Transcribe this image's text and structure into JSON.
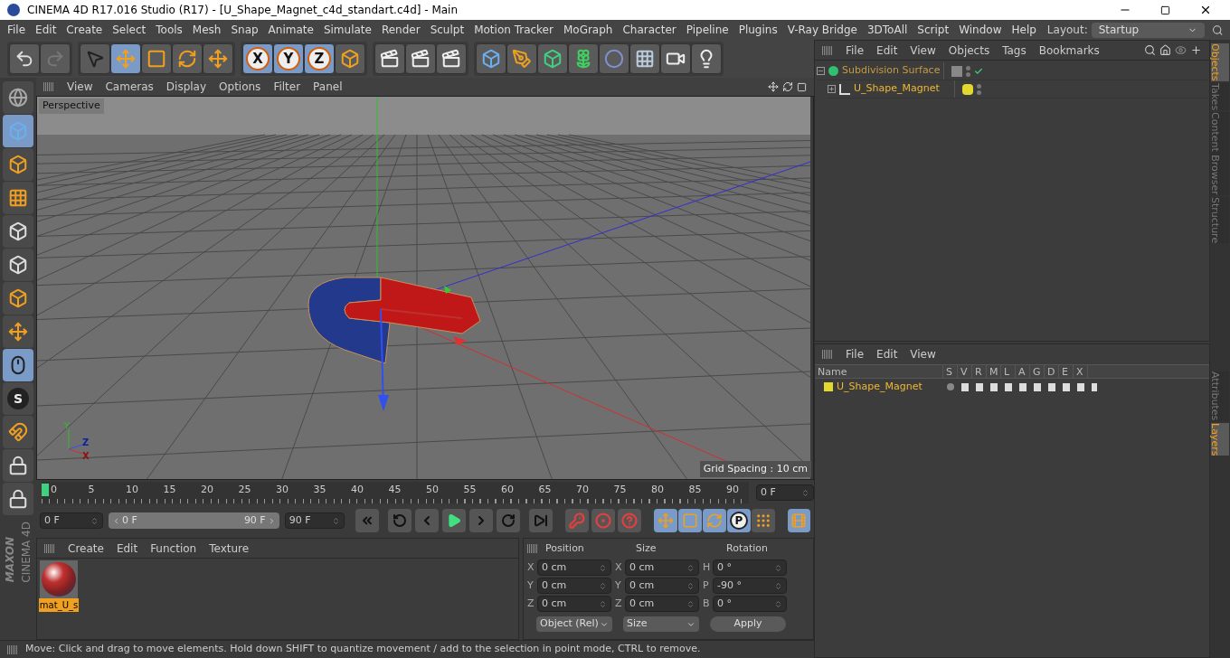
{
  "window": {
    "title": "CINEMA 4D R17.016 Studio (R17) - [U_Shape_Magnet_c4d_standart.c4d] - Main"
  },
  "menu": [
    "File",
    "Edit",
    "Create",
    "Select",
    "Tools",
    "Mesh",
    "Snap",
    "Animate",
    "Simulate",
    "Render",
    "Sculpt",
    "Motion Tracker",
    "MoGraph",
    "Character",
    "Pipeline",
    "Plugins",
    "V-Ray Bridge",
    "3DToAll",
    "Script",
    "Window",
    "Help"
  ],
  "layout": {
    "label": "Layout:",
    "value": "Startup"
  },
  "toolbar": [
    [
      {
        "kind": "undo",
        "selected": false
      },
      {
        "kind": "redo",
        "selected": false
      }
    ],
    [
      {
        "kind": "select",
        "selected": false
      },
      {
        "kind": "move",
        "selected": true
      },
      {
        "kind": "scale",
        "selected": false
      },
      {
        "kind": "rotate",
        "selected": false
      },
      {
        "kind": "move",
        "selected": false
      }
    ],
    [
      {
        "kind": "axis",
        "label": "X",
        "selected": true
      },
      {
        "kind": "axis",
        "label": "Y",
        "selected": true
      },
      {
        "kind": "axis",
        "label": "Z",
        "selected": true
      },
      {
        "kind": "coords",
        "selected": false
      }
    ],
    [
      {
        "kind": "render",
        "selected": false
      },
      {
        "kind": "render",
        "selected": false
      },
      {
        "kind": "render",
        "selected": false
      }
    ],
    [
      {
        "kind": "cube",
        "selected": false
      },
      {
        "kind": "pen",
        "selected": false
      },
      {
        "kind": "subdivision",
        "selected": false
      },
      {
        "kind": "cloner",
        "selected": false
      },
      {
        "kind": "deformer",
        "selected": false
      },
      {
        "kind": "floor",
        "selected": false
      },
      {
        "kind": "camera",
        "selected": false
      },
      {
        "kind": "light",
        "selected": false
      }
    ]
  ],
  "left_tools": [
    {
      "kind": "globe",
      "selected": false
    },
    {
      "kind": "cube",
      "selected": true
    },
    {
      "kind": "checker",
      "selected": false
    },
    {
      "kind": "grid",
      "selected": false
    },
    {
      "kind": "points",
      "selected": false
    },
    {
      "kind": "edges",
      "selected": false
    },
    {
      "kind": "polygons",
      "selected": false
    },
    {
      "kind": "axis",
      "selected": false
    },
    {
      "kind": "mouse",
      "selected": true
    },
    {
      "kind": "snap",
      "label": "S",
      "selected": false
    },
    {
      "kind": "magnet",
      "selected": false
    },
    {
      "kind": "lock",
      "selected": false
    },
    {
      "kind": "lock",
      "selected": false
    }
  ],
  "brand": [
    "MAXON",
    "CINEMA 4D"
  ],
  "viewport": {
    "menu": [
      "View",
      "Cameras",
      "Display",
      "Options",
      "Filter",
      "Panel"
    ],
    "camera": "Perspective",
    "grid_spacing": "Grid Spacing : 10 cm",
    "gizmo": [
      "Y",
      "Z",
      "X"
    ]
  },
  "timeline": {
    "ticks": [
      "0",
      "5",
      "10",
      "15",
      "20",
      "25",
      "30",
      "35",
      "40",
      "45",
      "50",
      "55",
      "60",
      "65",
      "70",
      "75",
      "80",
      "85",
      "90"
    ],
    "level": 0,
    "frame": "0 F"
  },
  "transport": {
    "start": "0 F",
    "range": {
      "start": "0 F",
      "end": "90 F",
      "level": 1
    },
    "end": "90 F",
    "buttons": [
      {
        "kind": "first"
      },
      {
        "kind": "prev-key"
      },
      {
        "kind": "prev"
      },
      {
        "kind": "play"
      },
      {
        "kind": "next"
      },
      {
        "kind": "next-key"
      },
      {
        "kind": "last"
      }
    ],
    "record": [
      {
        "kind": "key"
      },
      {
        "kind": "auto"
      },
      {
        "kind": "question"
      }
    ],
    "keys": [
      {
        "kind": "move",
        "selected": true
      },
      {
        "kind": "scale",
        "selected": true
      },
      {
        "kind": "rotate",
        "selected": true
      },
      {
        "kind": "param",
        "label": "P",
        "selected": true
      },
      {
        "kind": "dots",
        "selected": false
      }
    ]
  },
  "materials": {
    "menu": [
      "Create",
      "Edit",
      "Function",
      "Texture"
    ],
    "items": [
      {
        "name": "mat_U_s",
        "selected": true
      }
    ]
  },
  "coordinates": {
    "headers": [
      "Position",
      "Size",
      "Rotation"
    ],
    "rows": [
      [
        {
          "label": "X",
          "value": "0 cm"
        },
        {
          "label": "X",
          "value": "0 cm"
        },
        {
          "label": "H",
          "value": "0 °"
        }
      ],
      [
        {
          "label": "Y",
          "value": "0 cm"
        },
        {
          "label": "Y",
          "value": "0 cm"
        },
        {
          "label": "P",
          "value": "-90 °"
        }
      ],
      [
        {
          "label": "Z",
          "value": "0 cm"
        },
        {
          "label": "Z",
          "value": "0 cm"
        },
        {
          "label": "B",
          "value": "0 °"
        }
      ]
    ],
    "dropdowns": [
      "Object (Rel)",
      "Size"
    ],
    "apply": "Apply"
  },
  "status_bar": "Move: Click and drag to move elements. Hold down SHIFT to quantize movement / add to the selection in point mode, CTRL to remove.",
  "objects": {
    "menu": [
      "File",
      "Edit",
      "View",
      "Objects",
      "Tags",
      "Bookmarks"
    ],
    "tree": [
      {
        "name": "Subdivision Surface",
        "kind": "subdivision",
        "expanded": true,
        "children": [
          {
            "name": "U_Shape_Magnet",
            "kind": "null",
            "expanded": false,
            "color": "#e3d82e"
          }
        ]
      }
    ]
  },
  "layers": {
    "menu": [
      "File",
      "Edit",
      "View"
    ],
    "columns": [
      "Name",
      "S",
      "V",
      "R",
      "M",
      "L",
      "A",
      "G",
      "D",
      "E",
      "X"
    ],
    "items": [
      {
        "name": "U_Shape_Magnet",
        "color": "#e3d82e"
      }
    ]
  },
  "side_tabs_top": [
    {
      "label": "Objects",
      "selected": true
    },
    {
      "label": "Takes",
      "selected": false
    },
    {
      "label": "Content Browser",
      "selected": false
    },
    {
      "label": "Structure",
      "selected": false
    }
  ],
  "side_tabs_bottom": [
    {
      "label": "Attributes",
      "selected": false
    },
    {
      "label": "Layers",
      "selected": true
    }
  ]
}
